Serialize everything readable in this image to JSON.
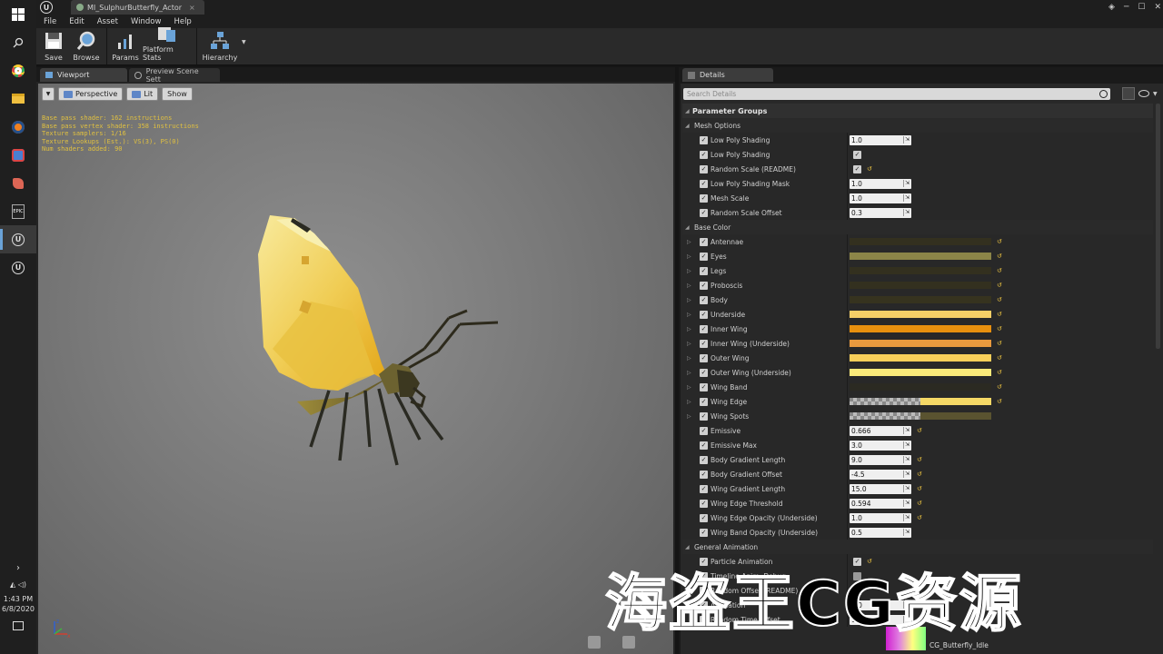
{
  "taskbar": {
    "icons": [
      "windows-icon",
      "search-icon",
      "chrome-icon",
      "file-explorer-icon",
      "blender-icon",
      "chrome-app-icon",
      "game-icon",
      "epic-games-icon",
      "unreal-editor-icon",
      "unreal-editor-icon"
    ],
    "epic_label": "EPIC",
    "time": "1:43 PM",
    "date": "6/8/2020"
  },
  "window": {
    "tab_title": "MI_SulphurButterfly_Actor",
    "close_glyph": "×"
  },
  "menu": [
    "File",
    "Edit",
    "Asset",
    "Window",
    "Help"
  ],
  "toolbar": {
    "save": "Save",
    "browse": "Browse",
    "params": "Params",
    "platform_stats": "Platform Stats",
    "hierarchy": "Hierarchy"
  },
  "viewport": {
    "tabs": [
      "Viewport",
      "Preview Scene Sett"
    ],
    "buttons": {
      "perspective": "Perspective",
      "lit": "Lit",
      "show": "Show"
    },
    "stats": [
      "Base pass shader: 162 instructions",
      "Base pass vertex shader: 358 instructions",
      "Texture samplers: 1/16",
      "Texture Lookups (Est.): VS(3), PS(0)",
      "Num shaders added: 90"
    ]
  },
  "details": {
    "tab": "Details",
    "search_placeholder": "Search Details",
    "root": "Parameter Groups",
    "groups": [
      {
        "name": "Mesh Options",
        "rows": [
          {
            "label": "Low Poly Shading",
            "kind": "num",
            "value": "1.0"
          },
          {
            "label": "Low Poly Shading",
            "kind": "bool",
            "value": "✓"
          },
          {
            "label": "Random Scale (README)",
            "kind": "bool",
            "value": "✓",
            "reset": true
          },
          {
            "label": "Low Poly Shading Mask",
            "kind": "num",
            "value": "1.0"
          },
          {
            "label": "Mesh Scale",
            "kind": "num",
            "value": "1.0"
          },
          {
            "label": "Random Scale Offset",
            "kind": "num",
            "value": "0.3"
          }
        ]
      },
      {
        "name": "Base Color",
        "rows": [
          {
            "label": "Antennae",
            "kind": "color",
            "color": "#33301f",
            "reset": true
          },
          {
            "label": "Eyes",
            "kind": "color",
            "color": "#8c8548",
            "reset": true
          },
          {
            "label": "Legs",
            "kind": "color",
            "color": "#33301f",
            "reset": true
          },
          {
            "label": "Proboscis",
            "kind": "color",
            "color": "#33301f",
            "reset": true
          },
          {
            "label": "Body",
            "kind": "color",
            "color": "#36331f",
            "reset": true
          },
          {
            "label": "Underside",
            "kind": "color",
            "color": "#f6cf67",
            "reset": true
          },
          {
            "label": "Inner Wing",
            "kind": "color",
            "color": "#e8900e",
            "reset": true
          },
          {
            "label": "Inner Wing (Underside)",
            "kind": "color",
            "color": "#e99a3e",
            "reset": true
          },
          {
            "label": "Outer Wing",
            "kind": "color",
            "color": "#f8cf5a",
            "reset": true
          },
          {
            "label": "Outer Wing (Underside)",
            "kind": "color",
            "color": "#faea7a",
            "reset": true
          },
          {
            "label": "Wing Band",
            "kind": "color",
            "color": "#2b2a22",
            "reset": true
          },
          {
            "label": "Wing Edge",
            "kind": "color",
            "color": "#f4d866",
            "checker": true,
            "reset": true
          },
          {
            "label": "Wing Spots",
            "kind": "color",
            "color": "#5a5330",
            "checker": true
          },
          {
            "label": "Emissive",
            "kind": "num",
            "value": "0.666",
            "reset": true
          },
          {
            "label": "Emissive Max",
            "kind": "num",
            "value": "3.0"
          },
          {
            "label": "Body Gradient Length",
            "kind": "num",
            "value": "9.0",
            "reset": true
          },
          {
            "label": "Body Gradient Offset",
            "kind": "num",
            "value": "-4.5",
            "reset": true
          },
          {
            "label": "Wing Gradient Length",
            "kind": "num",
            "value": "15.0",
            "reset": true
          },
          {
            "label": "Wing Edge Threshold",
            "kind": "num",
            "value": "0.594",
            "reset": true
          },
          {
            "label": "Wing Edge Opacity (Underside)",
            "kind": "num",
            "value": "1.0",
            "reset": true
          },
          {
            "label": "Wing Band Opacity (Underside)",
            "kind": "num",
            "value": "0.5"
          }
        ]
      },
      {
        "name": "General Animation",
        "rows": [
          {
            "label": "Particle Animation",
            "kind": "bool",
            "value": "✓",
            "reset": true
          },
          {
            "label": "Timeline Anim. Debug",
            "kind": "bool",
            "value": ""
          },
          {
            "label": "Random Offset (README)",
            "kind": "bool",
            "value": "✓"
          },
          {
            "label": "Animation",
            "kind": "num",
            "value": "1.0"
          },
          {
            "label": "Random Time Offset",
            "kind": "num",
            "value": "10.0"
          }
        ]
      }
    ],
    "footer_asset": "CG_Butterfly_Idle"
  },
  "watermark": "海盗王CG资源"
}
